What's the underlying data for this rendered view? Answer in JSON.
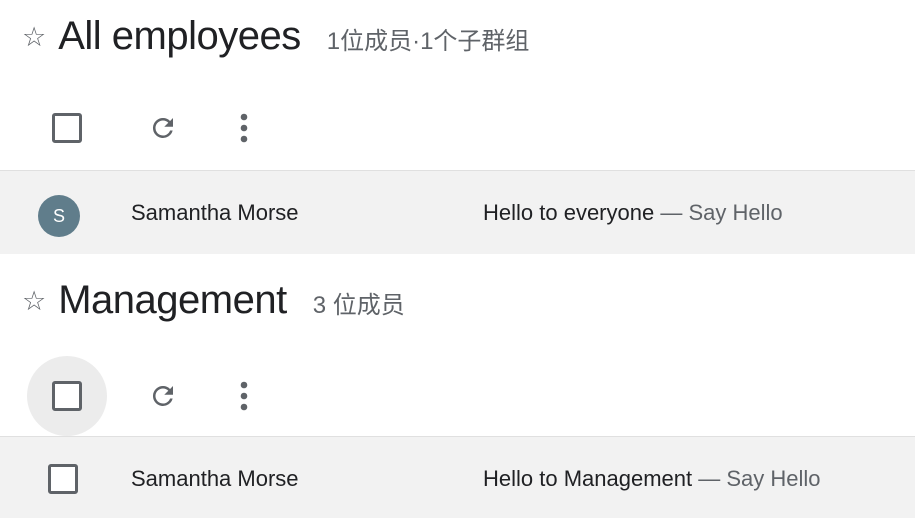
{
  "groups": [
    {
      "title": "All employees",
      "meta": "1位成员·1个子群组",
      "toolbar": {
        "checkbox_hover": false
      },
      "row": {
        "avatar_letter": "S",
        "sender": "Samantha Morse",
        "subject": "Hello to everyone",
        "separator": " — ",
        "snippet": "Say Hello"
      }
    },
    {
      "title": "Management",
      "meta": "3 位成员",
      "toolbar": {
        "checkbox_hover": true
      },
      "row": {
        "sender": "Samantha Morse",
        "subject": "Hello to Management",
        "separator": " — ",
        "snippet": "Say Hello"
      }
    }
  ],
  "icons": {
    "star": "star-outline-icon",
    "refresh": "refresh-icon",
    "more": "more-vert-icon"
  },
  "colors": {
    "avatar_bg": "#607d8b",
    "row_bg": "#f2f2f2",
    "text_primary": "#202124",
    "text_secondary": "#5f6368"
  }
}
